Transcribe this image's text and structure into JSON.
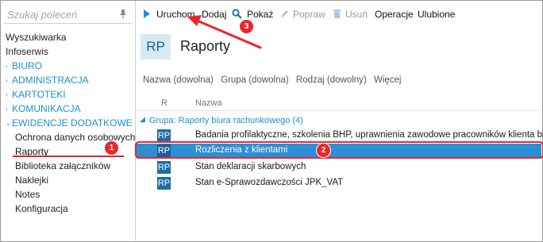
{
  "sidebar": {
    "search_placeholder": "Szukaj poleceń",
    "items": [
      {
        "label": "Wyszukiwarka"
      },
      {
        "label": "Infoserwis"
      },
      {
        "label": "BIURO"
      },
      {
        "label": "ADMINISTRACJA"
      },
      {
        "label": "KARTOTEKI"
      },
      {
        "label": "KOMUNIKACJA"
      },
      {
        "label": "EWIDENCJE DODATKOWE"
      },
      {
        "label": "Ochrona danych osobowych"
      },
      {
        "label": "Raporty"
      },
      {
        "label": "Biblioteka załączników"
      },
      {
        "label": "Naklejki"
      },
      {
        "label": "Notes"
      },
      {
        "label": "Konfiguracja"
      }
    ]
  },
  "toolbar": {
    "run_label": "Uruchom",
    "add_label": "Dodaj",
    "show_label": "Pokaż",
    "edit_label": "Popraw",
    "delete_label": "Usuń",
    "operations_label": "Operacje",
    "favorites_label": "Ulubione"
  },
  "header": {
    "badge": "RP",
    "title": "Raporty"
  },
  "filters": {
    "name": "Nazwa (dowolna)",
    "group": "Grupa (dowolna)",
    "type": "Rodzaj (dowolny)",
    "more": "Więcej"
  },
  "table": {
    "columns": [
      "R",
      "Nazwa"
    ],
    "group_label": "Grupa: Raporty biura rachunkowego (4)",
    "rows": [
      {
        "icon": "RP",
        "name": "Badania profilaktyczne, szkolenia BHP, uprawnienia zawodowe pracowników klienta biura"
      },
      {
        "icon": "RP",
        "name": "Rozliczenia z klientami"
      },
      {
        "icon": "RP",
        "name": "Stan deklaracji skarbowych"
      },
      {
        "icon": "RP",
        "name": "Stan e-Sprawozdawczości JPK_VAT"
      }
    ]
  },
  "annotations": {
    "step1": "1",
    "step2": "2",
    "step3": "3"
  },
  "colors": {
    "accent": "#1f8fd1",
    "selected_row": "#2b8fd6",
    "annotation_red": "#e8272c",
    "rp_badge_bg": "#d7e9f4"
  }
}
